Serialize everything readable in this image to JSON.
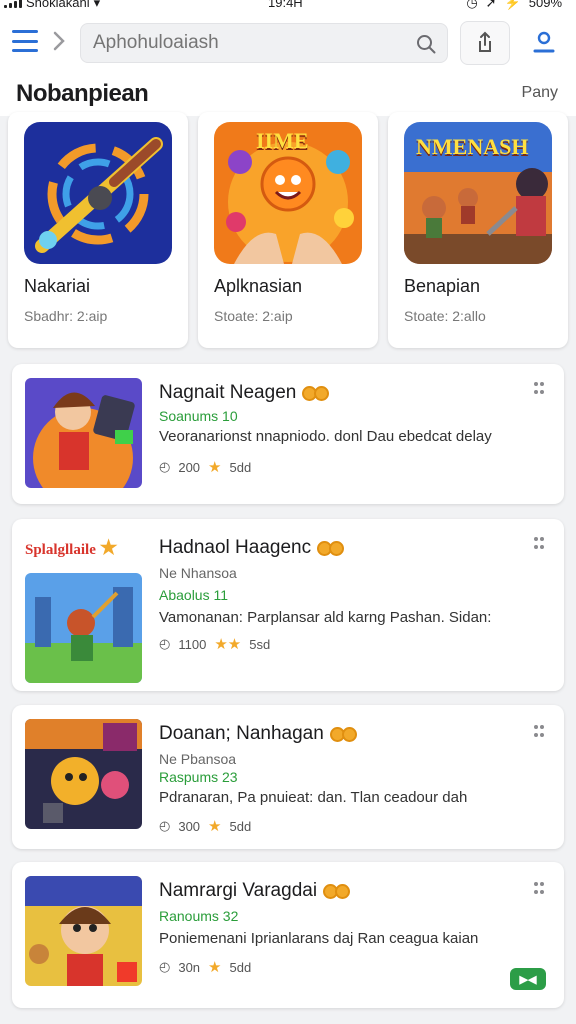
{
  "status_bar": {
    "carrier": "Shokiakani",
    "time": "19:4H",
    "battery": "509%"
  },
  "search": {
    "placeholder": "Aphohuloaiash"
  },
  "section": {
    "title": "Nobanpiean",
    "link": "Pany"
  },
  "featured": [
    {
      "name": "Nakariai",
      "subtitle": "Sbadhr: 2:aip",
      "icon": "brush-wheel-icon",
      "colors": [
        "#2c3e9e",
        "#f2a92a"
      ]
    },
    {
      "name": "Aplknasian",
      "subtitle": "Stoate: 2:aip",
      "icon": "time-game-icon",
      "banner": "IIME",
      "colors": [
        "#f07a1a",
        "#ffd23a"
      ]
    },
    {
      "name": "Benapian",
      "subtitle": "Stoate: 2:allo",
      "icon": "hero-game-icon",
      "banner": "NMENASH",
      "colors": [
        "#3a6fd0",
        "#f5c21a"
      ]
    }
  ],
  "list": [
    {
      "title": "Nagnait Neagen",
      "subtitle": "",
      "green": "Soanums 10",
      "desc": "Veoranarionst nnapniodo. donl Dau ebedcat delay",
      "meta": "200",
      "rating": "5dd",
      "badge": ""
    },
    {
      "title": "Hadnaol Haagenc",
      "subtitle": "Ne Nhansoa",
      "green": "Abaolus 11",
      "desc": "Vamonanan: Parplansar ald karng Pashan. Sidan:",
      "meta": "1100",
      "rating": "5sd",
      "badge": "Splalgllaile"
    },
    {
      "title": "Doanan; Nanhagan",
      "subtitle": "Ne Pbansoa",
      "green": "Raspums 23",
      "desc": "Pdranaran, Pa pnuieat: dan. Tlan ceadour dah",
      "meta": "300",
      "rating": "5dd",
      "badge": ""
    },
    {
      "title": "Namrargi Varagdai",
      "subtitle": "",
      "green": "Ranoums 32",
      "desc": "Poniemenani Iprianlarans daj Ran ceagua kaian",
      "meta": "30n",
      "rating": "5dd",
      "badge": ""
    }
  ],
  "colors": {
    "accent": "#2b6fd6",
    "green": "#2a9d3a",
    "gold": "#f2a92a"
  }
}
